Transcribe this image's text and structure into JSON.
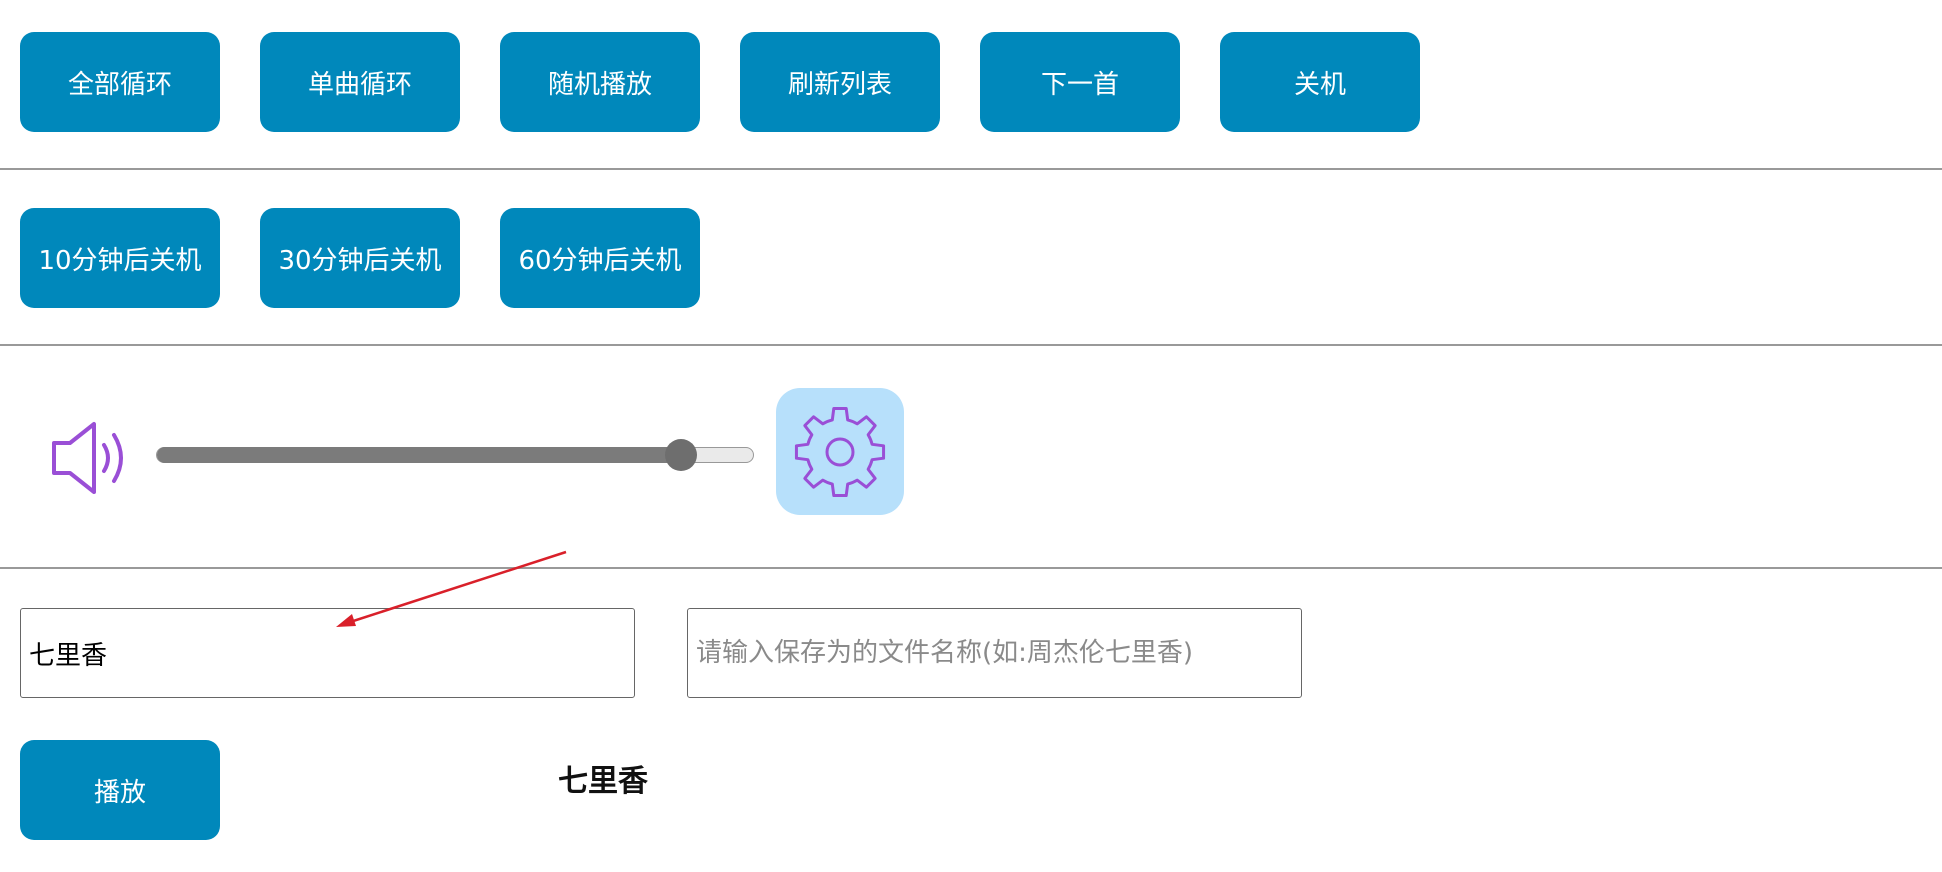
{
  "controls": {
    "loop_all": "全部循环",
    "loop_one": "单曲循环",
    "shuffle": "随机播放",
    "refresh": "刷新列表",
    "next": "下一首",
    "shutdown": "关机"
  },
  "timers": {
    "t10": "10分钟后关机",
    "t30": "30分钟后关机",
    "t60": "60分钟后关机"
  },
  "volume": {
    "icon": "speaker-icon",
    "level": 0.88,
    "settings_icon": "gear-icon"
  },
  "search": {
    "value": "七里香",
    "save_placeholder": "请输入保存为的文件名称(如:周杰伦七里香)"
  },
  "player": {
    "play_label": "播放",
    "now_playing": "七里香"
  },
  "colors": {
    "button_bg": "#0088bb",
    "gear_bg": "#b7e0fb",
    "icon_purple": "#9a4fd6",
    "arrow_red": "#d9202a"
  }
}
